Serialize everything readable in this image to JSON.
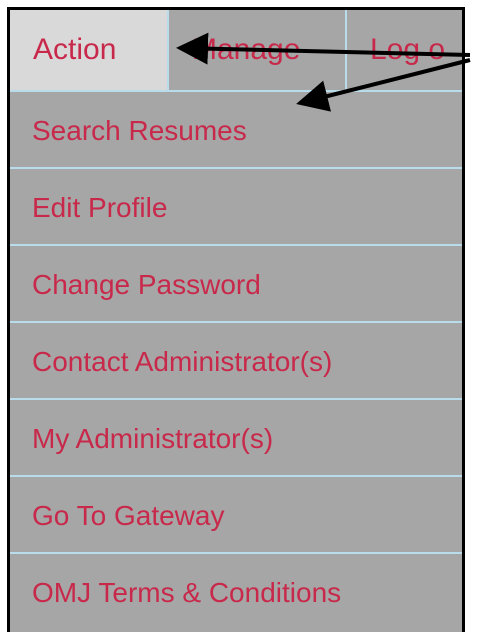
{
  "tabs": [
    {
      "label": "Action"
    },
    {
      "label": "Manage"
    },
    {
      "label": "Log o"
    }
  ],
  "menu_items": [
    {
      "label": "Search Resumes"
    },
    {
      "label": "Edit Profile"
    },
    {
      "label": "Change Password"
    },
    {
      "label": "Contact Administrator(s)"
    },
    {
      "label": "My Administrator(s)"
    },
    {
      "label": "Go To Gateway"
    },
    {
      "label": "OMJ Terms & Conditions"
    }
  ],
  "colors": {
    "link_text": "#c8294b",
    "menu_background": "#a6a6a6",
    "active_tab_background": "#d9d9d9",
    "divider": "#b9dcea",
    "annotation_arrow": "#000000"
  }
}
